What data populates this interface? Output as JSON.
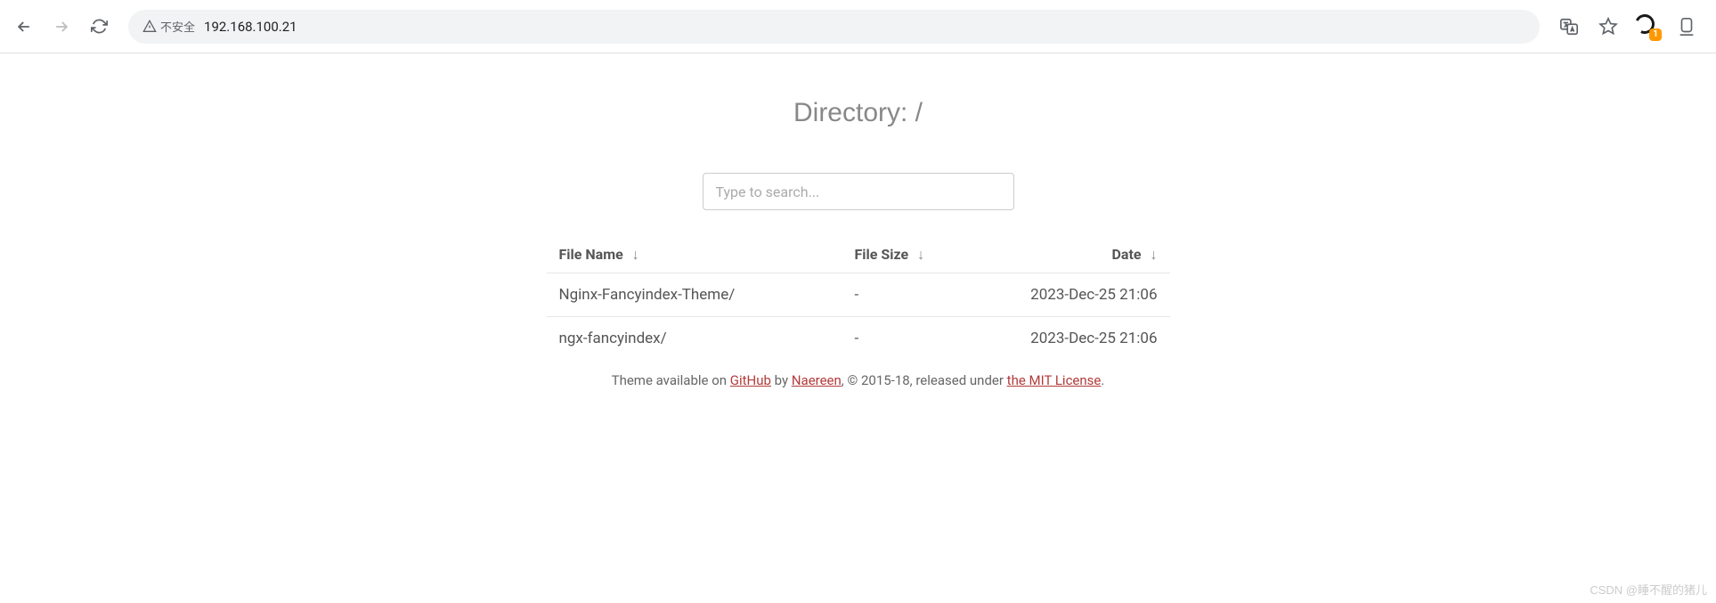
{
  "browser": {
    "security_label": "不安全",
    "url": "192.168.100.21",
    "extension_badge": "1"
  },
  "page": {
    "title": "Directory: /",
    "search_placeholder": "Type to search...",
    "headers": {
      "name": "File Name",
      "size": "File Size",
      "date": "Date",
      "sort_indicator": "↓"
    },
    "rows": [
      {
        "name": "Nginx-Fancyindex-Theme/",
        "size": "-",
        "date": "2023-Dec-25 21:06"
      },
      {
        "name": "ngx-fancyindex/",
        "size": "-",
        "date": "2023-Dec-25 21:06"
      }
    ],
    "footer": {
      "prefix": "Theme available on ",
      "link1": "GitHub",
      "mid1": " by ",
      "link2": "Naereen",
      "mid2": ", © 2015-18, released under ",
      "link3": "the MIT License",
      "suffix": "."
    }
  },
  "watermark": "CSDN @睡不醒的猪儿"
}
